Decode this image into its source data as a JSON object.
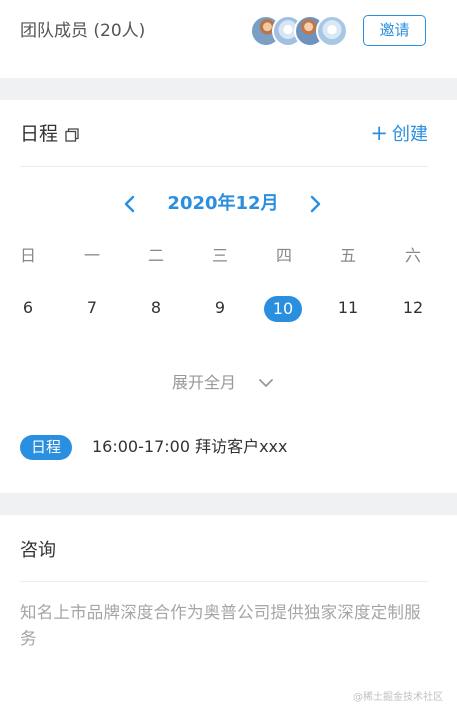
{
  "team": {
    "title": "团队成员 (20人)",
    "invite_label": "邀请"
  },
  "schedule": {
    "title": "日程",
    "create_label": "创建",
    "month_label": "2020年12月",
    "weekdays": [
      "日",
      "一",
      "二",
      "三",
      "四",
      "五",
      "六"
    ],
    "days": [
      "6",
      "7",
      "8",
      "9",
      "10",
      "11",
      "12"
    ],
    "selected_day": "10",
    "expand_label": "展开全月",
    "event": {
      "badge": "日程",
      "text": "16:00-17:00 拜访客户xxx"
    }
  },
  "consult": {
    "title": "咨询",
    "description": "知名上市品牌深度合作为奥普公司提供独家深度定制服务"
  },
  "watermark": "@稀土掘金技术社区",
  "colors": {
    "accent": "#2b8fe0",
    "background_gap": "#f0f1f3",
    "muted_text": "#a5a5a5"
  }
}
